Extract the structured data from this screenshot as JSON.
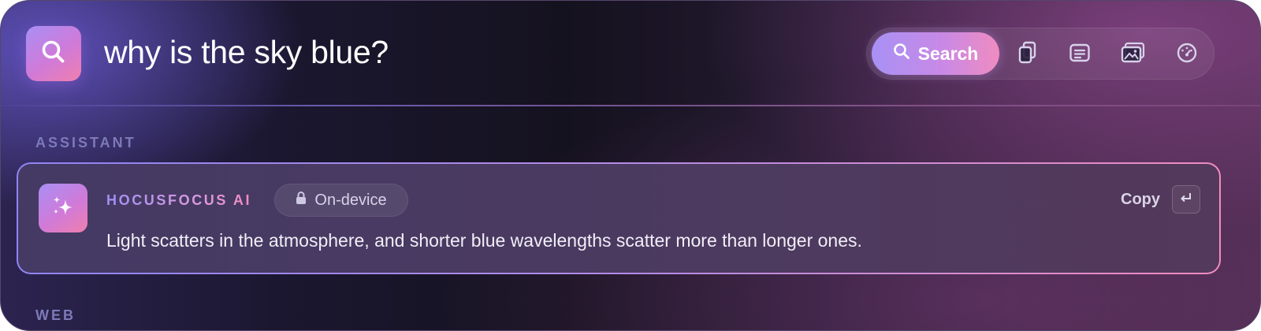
{
  "search": {
    "query": "why is the sky blue?"
  },
  "toolbar": {
    "search_label": "Search",
    "buttons": [
      {
        "icon": "clipboard-icon"
      },
      {
        "icon": "document-text-icon"
      },
      {
        "icon": "image-gallery-icon"
      },
      {
        "icon": "speedometer-icon"
      }
    ]
  },
  "sections": {
    "assistant": "ASSISTANT",
    "web": "WEB"
  },
  "assistant_card": {
    "brand": "HOCUSFOCUS AI",
    "badge": "On-device",
    "answer": "Light scatters in the atmosphere, and shorter blue wavelengths scatter more than longer ones.",
    "copy_label": "Copy",
    "enter_icon": "return-key-icon"
  },
  "colors": {
    "accent_start": "#a891f5",
    "accent_end": "#f08cc0",
    "section_label": "#7d7ab8"
  }
}
